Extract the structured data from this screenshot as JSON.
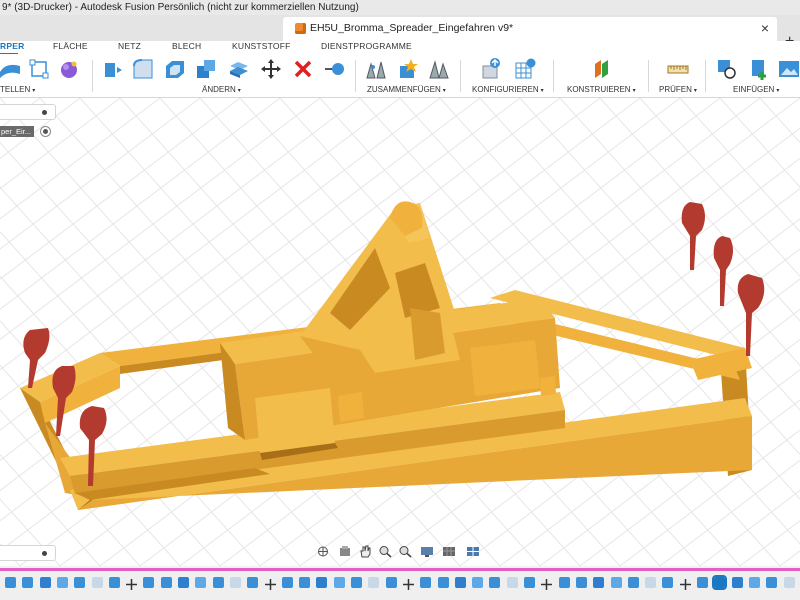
{
  "window": {
    "title": "9* (3D-Drucker) - Autodesk Fusion Persönlich (nicht zur kommerziellen Nutzung)"
  },
  "document_tab": {
    "label": "EH5U_Bromma_Spreader_Eingefahren v9*",
    "close": "×",
    "new_tab": "+"
  },
  "ribbon": {
    "tabs": [
      "RPER",
      "FLÄCHE",
      "NETZ",
      "BLECH",
      "KUNSTSTOFF",
      "DIENSTPROGRAMME"
    ],
    "groups": [
      "TELLEN",
      "ÄNDERN",
      "ZUSAMMENFÜGEN",
      "KONFIGURIEREN",
      "KONSTRUIEREN",
      "PRÜFEN",
      "EINFÜGEN"
    ],
    "dropdown_glyph": "▾"
  },
  "browser": {
    "item_label": "per_Eir..."
  },
  "colors": {
    "accent": "#1a78c2",
    "model": "#f0b23c",
    "model_dark": "#c98a22",
    "model_shadow": "#a86f18",
    "markers": "#b33a2e",
    "timeline_bar": "#e25fc4"
  },
  "icons": {
    "ribbon": [
      "sphere-icon",
      "sketch-icon",
      "form-icon",
      "extrude-icon",
      "press-pull-icon",
      "fillet-icon",
      "shell-icon",
      "combine-icon",
      "move-icon",
      "delete-icon",
      "physical-material-icon",
      "joint-icon",
      "as-built-joint-icon",
      "rigid-group-icon",
      "configure-table-icon",
      "configure-icon",
      "offset-plane-icon",
      "measure-icon",
      "insert-derive-icon",
      "insert-mesh-icon",
      "insert-image-icon"
    ],
    "navbar": [
      "orbit-icon",
      "look-at-icon",
      "pan-icon",
      "zoom-icon",
      "fit-icon",
      "display-settings-icon",
      "grid-settings-icon",
      "viewports-icon"
    ]
  }
}
